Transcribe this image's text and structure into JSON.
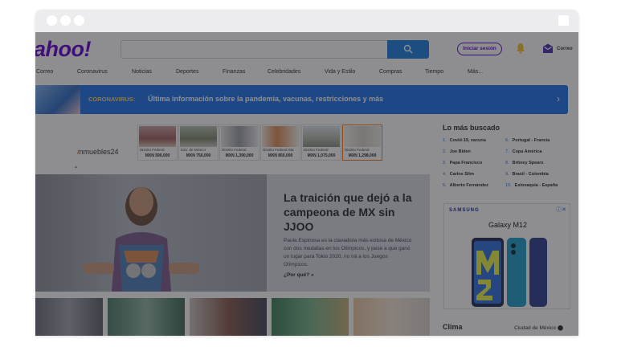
{
  "header": {
    "logo": "ahoo!",
    "signin": "Iniciar sesión",
    "mail_label": "Correo"
  },
  "nav": [
    "Correo",
    "Coronavirus",
    "Noticias",
    "Deportes",
    "Finanzas",
    "Celebridades",
    "Vida y Estilo",
    "Compras",
    "Tiempo",
    "Más..."
  ],
  "banner": {
    "tag": "CORONAVIRUS:",
    "text": "Última información sobre la pandemia, vacunas, restricciones y más"
  },
  "ad": {
    "brand_prefix": "i",
    "brand": "nmuebles24",
    "listings": [
      {
        "loc": "Distrito Federal",
        "price": "MXN 590,000"
      },
      {
        "loc": "Edo. de México",
        "price": "MXN 750,000"
      },
      {
        "loc": "Distrito Federal",
        "price": "MXN 1,390,000"
      },
      {
        "loc": "Distrito Federal Sta",
        "price": "MXN 850,000"
      },
      {
        "loc": "Distrito Federal",
        "price": "MXN 1,075,000"
      },
      {
        "loc": "Distrito Federal",
        "price": "MXN 1,298,000"
      }
    ]
  },
  "hero": {
    "headline": "La traición que dejó a la campeona de MX sin JJOO",
    "body": "Paola Espinosa es la clavadista más exitosa de México con dos medallas en los Olímpicos, y pese a que ganó un lugar para Tokio 2020, no irá a los Juegos Olímpicos.",
    "link": "¿Por qué? »"
  },
  "trending": {
    "title": "Lo más buscado",
    "items": [
      {
        "n": "1.",
        "label": "Covid-19, vacuna"
      },
      {
        "n": "2.",
        "label": "Joe Biden"
      },
      {
        "n": "3.",
        "label": "Papa Francisco"
      },
      {
        "n": "4.",
        "label": "Carlos Slim"
      },
      {
        "n": "5.",
        "label": "Alberto Fernández"
      },
      {
        "n": "6.",
        "label": "Portugal - Francia"
      },
      {
        "n": "7.",
        "label": "Copa América"
      },
      {
        "n": "8.",
        "label": "Britney Spears"
      },
      {
        "n": "9.",
        "label": "Brasil - Colombia"
      },
      {
        "n": "10.",
        "label": "Eslovaquia - España"
      }
    ]
  },
  "side_ad": {
    "brand": "SAMSUNG",
    "model": "Galaxy M12"
  },
  "weather": {
    "title": "Clima",
    "city": "Ciudad de México"
  },
  "colors": {
    "brand": "#6001d2",
    "accent": "#1e73e8",
    "banner_tag": "#ffd36b"
  }
}
